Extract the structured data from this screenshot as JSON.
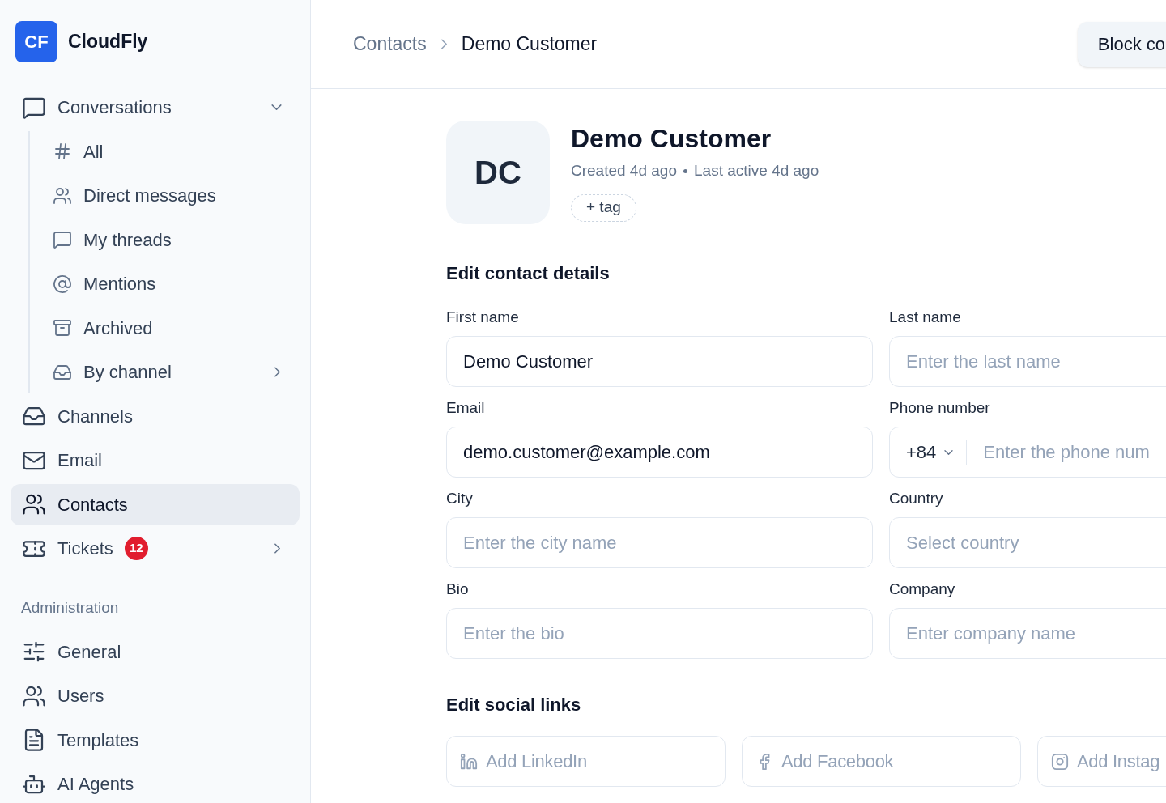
{
  "sidebar": {
    "brand": {
      "logo_text": "CF",
      "name": "CloudFly"
    },
    "nav": [
      {
        "label": "Conversations",
        "selected": false,
        "expanded": true,
        "children": [
          {
            "label": "All",
            "selected": false
          },
          {
            "label": "Direct messages",
            "selected": false
          },
          {
            "label": "My threads",
            "selected": false
          },
          {
            "label": "Mentions",
            "selected": false
          },
          {
            "label": "Archived",
            "selected": false
          },
          {
            "label": "By channel",
            "selected": false,
            "has_submenu": true
          }
        ]
      },
      {
        "label": "Channels",
        "selected": false
      },
      {
        "label": "Email",
        "selected": false
      },
      {
        "label": "Contacts",
        "selected": true
      },
      {
        "label": "Tickets",
        "selected": false,
        "badge": "12",
        "has_submenu": true
      }
    ],
    "section_title": "Administration",
    "admin": [
      {
        "label": "General",
        "selected": false
      },
      {
        "label": "Users",
        "selected": false
      },
      {
        "label": "Templates",
        "selected": false
      },
      {
        "label": "AI Agents",
        "selected": false
      }
    ]
  },
  "breadcrumb": [
    "Contacts",
    "Demo Customer"
  ],
  "header_button": "Block co",
  "contact": {
    "initials": "DC",
    "name": "Demo Customer",
    "created": "Created 4d ago",
    "last_active": "Last active 4d ago",
    "tag_button": "+ tag"
  },
  "details": {
    "title": "Edit contact details",
    "fields": [
      {
        "kind": "text",
        "label": "First name",
        "value": "Demo Customer"
      },
      {
        "kind": "text",
        "label": "Last name",
        "placeholder": "Enter the last name"
      },
      {
        "kind": "text",
        "label": "Email",
        "value": "demo.customer@example.com"
      },
      {
        "kind": "phone",
        "label": "Phone number",
        "code": "+84",
        "placeholder": "Enter the phone num"
      },
      {
        "kind": "text",
        "label": "City",
        "placeholder": "Enter the city name"
      },
      {
        "kind": "select",
        "label": "Country",
        "placeholder": "Select country"
      },
      {
        "kind": "text",
        "label": "Bio",
        "placeholder": "Enter the bio"
      },
      {
        "kind": "text",
        "label": "Company",
        "placeholder": "Enter company name"
      }
    ]
  },
  "social": {
    "title": "Edit social links",
    "fields": [
      {
        "kind": "linkedin",
        "placeholder": "Add LinkedIn"
      },
      {
        "kind": "facebook",
        "placeholder": "Add Facebook"
      },
      {
        "kind": "instagram",
        "placeholder": "Add Instag"
      }
    ]
  }
}
